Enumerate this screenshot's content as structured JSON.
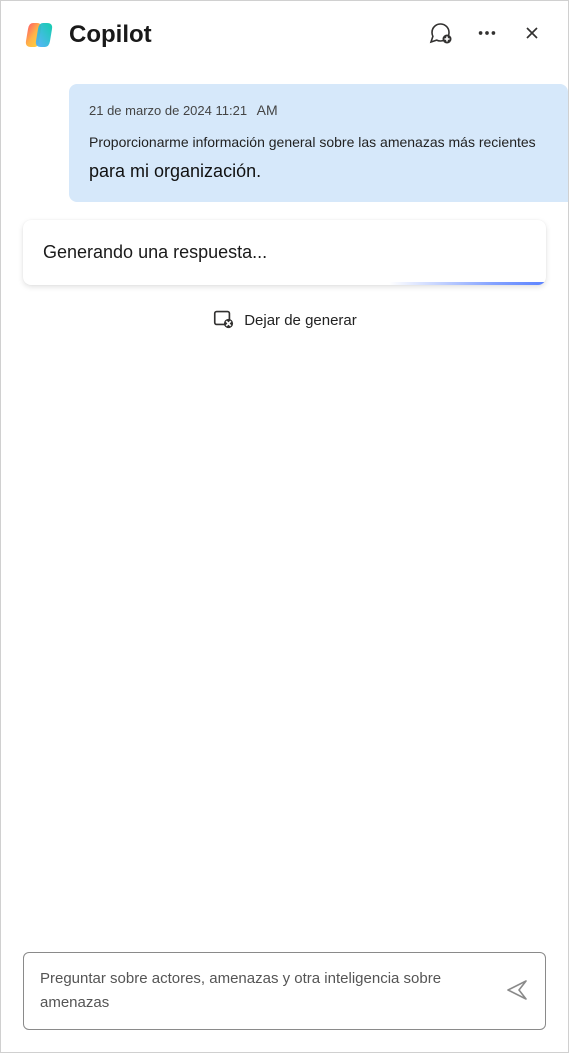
{
  "header": {
    "title": "Copilot"
  },
  "user_message": {
    "date": "21 de marzo de 2024 11:21",
    "ampm": "AM",
    "line1": "Proporcionarme información general sobre las amenazas más recientes",
    "line2": "para mi organización."
  },
  "response": {
    "generating": "Generando una respuesta..."
  },
  "stop": {
    "label": "Dejar de generar"
  },
  "input": {
    "placeholder": "Preguntar sobre actores, amenazas y otra inteligencia sobre amenazas"
  }
}
